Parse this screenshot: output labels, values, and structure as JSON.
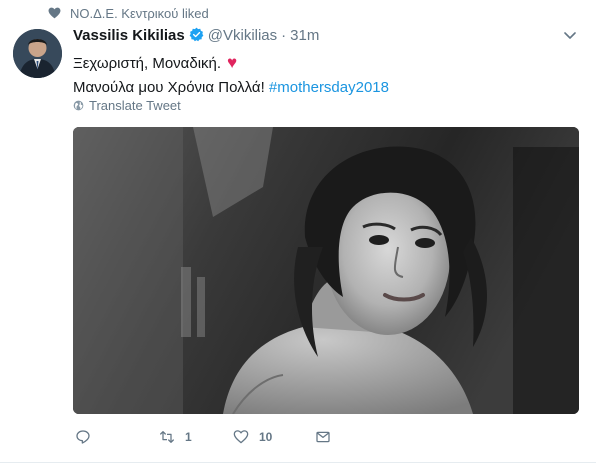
{
  "liked_by": "ΝΟ.Δ.Ε. Κεντρικού liked",
  "tweet": {
    "author_name": "Vassilis Kikilias",
    "handle": "@Vkikilias",
    "separator": "·",
    "time": "31m",
    "line1": "Ξεχωριστή, Μοναδική.",
    "heart_emoji": "♥",
    "line2_prefix": "Μανούλα μου Χρόνια Πολλά! ",
    "hashtag": "#mothersday2018",
    "translate_label": "Translate Tweet"
  },
  "actions": {
    "reply_count": "",
    "retweet_count": "1",
    "like_count": "10"
  },
  "colors": {
    "accent": "#1b95e0",
    "muted": "#657786",
    "heart": "#e0245e"
  },
  "icons": [
    "heart-icon",
    "verified-badge-icon",
    "chevron-down-icon",
    "globe-icon",
    "reply-icon",
    "retweet-icon",
    "like-icon",
    "direct-message-icon"
  ]
}
